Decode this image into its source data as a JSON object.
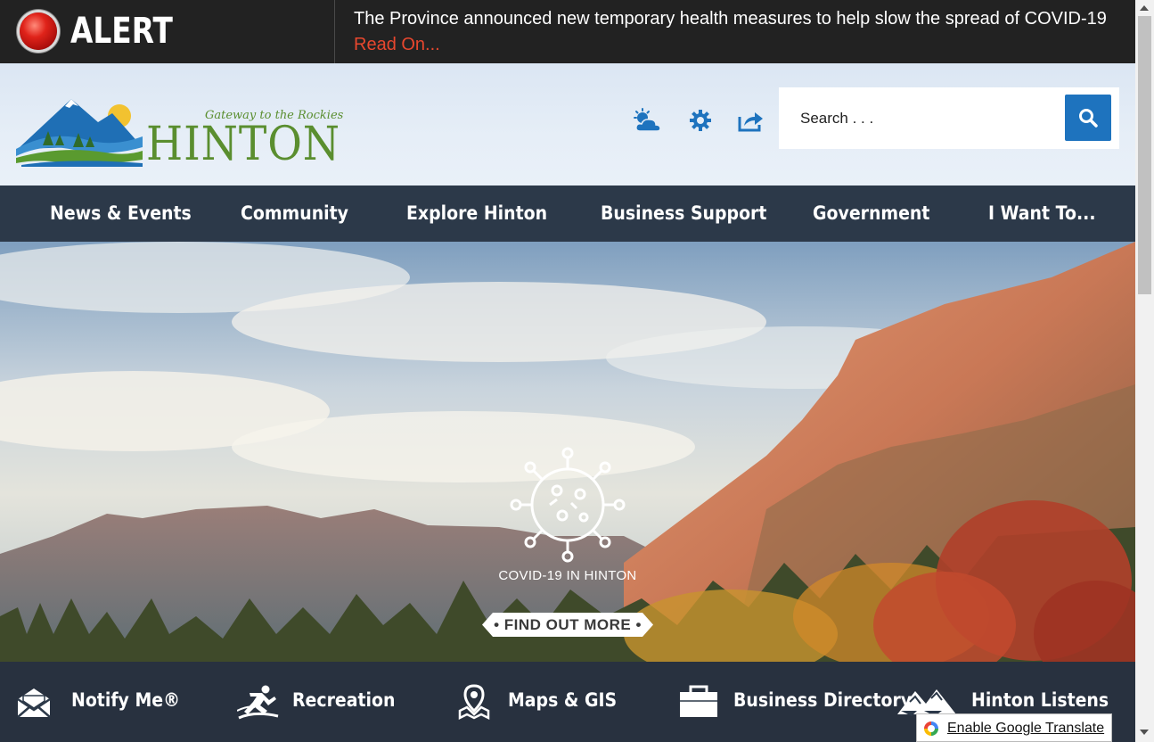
{
  "alert": {
    "label": "ALERT",
    "message": "The Province announced new temporary health measures to help slow the spread of COVID-19",
    "link": "Read On..."
  },
  "header": {
    "logo_tagline": "Gateway to the Rockies",
    "logo_name": "HINTON",
    "tools": [
      {
        "icon": "weather-icon"
      },
      {
        "icon": "settings-gear-icon"
      },
      {
        "icon": "share-icon"
      }
    ],
    "search": {
      "placeholder": "Search . . ."
    }
  },
  "nav": {
    "items": [
      {
        "label": "News & Events"
      },
      {
        "label": "Community"
      },
      {
        "label": "Explore Hinton"
      },
      {
        "label": "Business Support"
      },
      {
        "label": "Government"
      },
      {
        "label": "I Want To..."
      }
    ]
  },
  "hero": {
    "caption": "COVID-19 IN HINTON",
    "button": "• FIND OUT MORE •"
  },
  "quick_links": [
    {
      "label": "Notify Me®",
      "icon": "envelope-icon"
    },
    {
      "label": "Recreation",
      "icon": "runner-icon"
    },
    {
      "label": "Maps & GIS",
      "icon": "map-pin-icon"
    },
    {
      "label": "Business Directory",
      "icon": "briefcase-icon"
    },
    {
      "label": "Hinton Listens",
      "icon": "mountain-icon"
    }
  ],
  "translate": {
    "label": "Enable Google Translate"
  },
  "colors": {
    "alert_bg": "#222222",
    "alert_link": "#e8472e",
    "nav_bg": "#2c3949",
    "accent_blue": "#1e73be",
    "logo_green": "#5a8e2f"
  }
}
